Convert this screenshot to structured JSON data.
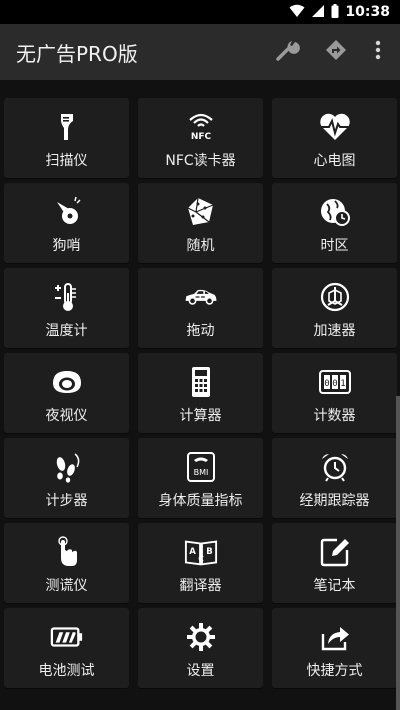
{
  "status": {
    "time": "10:38"
  },
  "app": {
    "title": "无广告PRO版"
  },
  "tools": [
    {
      "label": "扫描仪",
      "icon": "barcode-scanner-icon"
    },
    {
      "label": "NFC读卡器",
      "icon": "nfc-icon"
    },
    {
      "label": "心电图",
      "icon": "heart-ecg-icon"
    },
    {
      "label": "狗哨",
      "icon": "whistle-icon"
    },
    {
      "label": "随机",
      "icon": "dice-icon"
    },
    {
      "label": "时区",
      "icon": "globe-clock-icon"
    },
    {
      "label": "温度计",
      "icon": "thermometer-icon"
    },
    {
      "label": "拖动",
      "icon": "car-icon"
    },
    {
      "label": "加速器",
      "icon": "accelerometer-icon"
    },
    {
      "label": "夜视仪",
      "icon": "night-vision-icon"
    },
    {
      "label": "计算器",
      "icon": "calculator-icon"
    },
    {
      "label": "计数器",
      "icon": "counter-icon"
    },
    {
      "label": "计步器",
      "icon": "footsteps-icon"
    },
    {
      "label": "身体质量指标",
      "icon": "bmi-scale-icon"
    },
    {
      "label": "经期跟踪器",
      "icon": "alarm-clock-icon"
    },
    {
      "label": "测谎仪",
      "icon": "finger-touch-icon"
    },
    {
      "label": "翻译器",
      "icon": "translate-book-icon"
    },
    {
      "label": "笔记本",
      "icon": "notepad-icon"
    },
    {
      "label": "电池测试",
      "icon": "battery-icon"
    },
    {
      "label": "设置",
      "icon": "gear-icon"
    },
    {
      "label": "快捷方式",
      "icon": "share-icon"
    }
  ]
}
